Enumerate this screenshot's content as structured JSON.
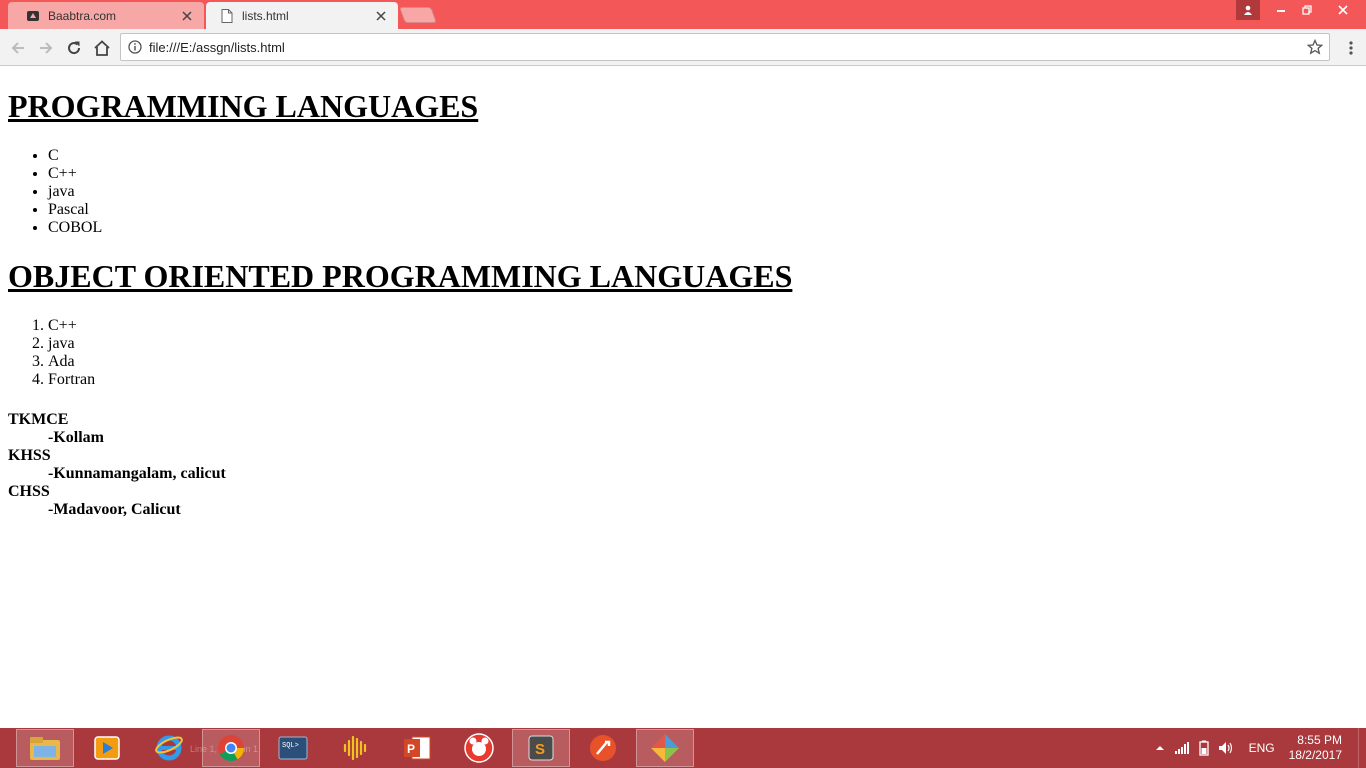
{
  "browser": {
    "tabs": [
      {
        "title": "Baabtra.com",
        "active": false
      },
      {
        "title": "lists.html",
        "active": true
      }
    ],
    "address_bar": {
      "url": "file:///E:/assgn/lists.html"
    }
  },
  "page": {
    "heading1": "PROGRAMMING LANGUAGES",
    "unordered_list": [
      "C",
      "C++",
      "java",
      "Pascal",
      "COBOL"
    ],
    "heading2": "OBJECT ORIENTED PROGRAMMING LANGUAGES",
    "ordered_list": [
      "C++",
      "java",
      "Ada",
      "Fortran"
    ],
    "definition_list": [
      {
        "term": "TKMCE",
        "description": "-Kollam"
      },
      {
        "term": "KHSS",
        "description": "-Kunnamangalam, calicut"
      },
      {
        "term": "CHSS",
        "description": "-Madavoor, Calicut"
      }
    ]
  },
  "taskbar": {
    "apps": [
      "file-explorer",
      "media-player",
      "internet-explorer",
      "chrome",
      "sql-plus",
      "audio-app",
      "powerpoint",
      "game-center",
      "sublime-text",
      "filezilla",
      "git"
    ],
    "ghost_text": "Line 1, Column 1",
    "tray": {
      "language": "ENG",
      "time": "8:55 PM",
      "date": "18/2/2017"
    }
  },
  "colors": {
    "chrome_titlebar": "#f45758",
    "taskbar": "#a9393d"
  }
}
